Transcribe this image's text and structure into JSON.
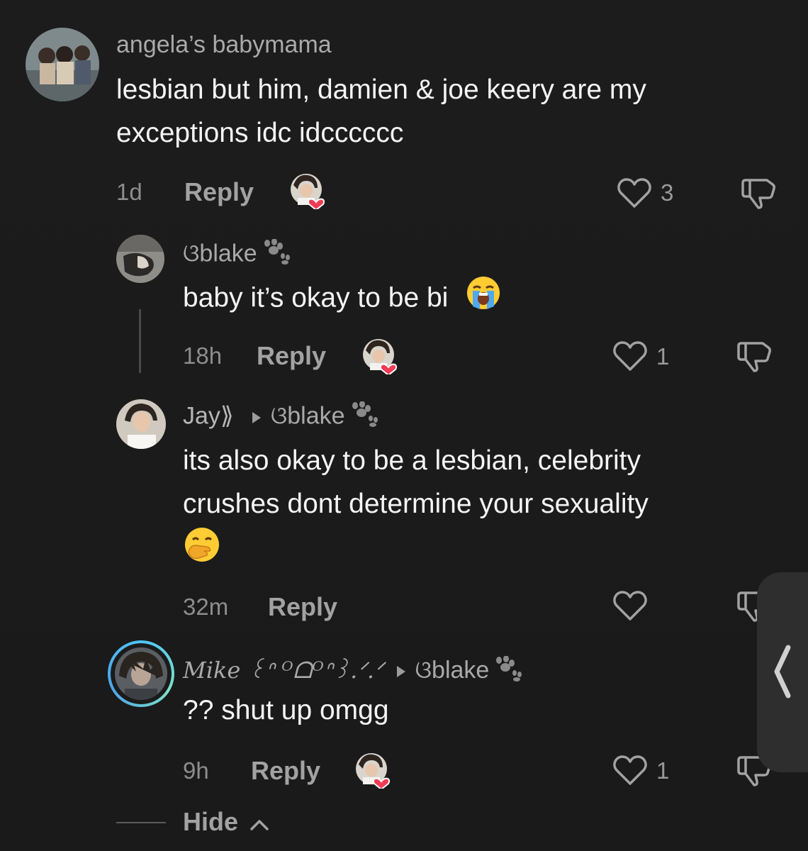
{
  "comments": [
    {
      "username": "angela’s babymama",
      "lines": [
        "lesbian but him, damien & joe keery are my",
        "exceptions idc idcccccc"
      ],
      "time": "1d",
      "reply_label": "Reply",
      "like_count": "3"
    },
    {
      "username": "ଓblake",
      "text": "baby it’s okay to be bi",
      "emoji": "loudly-crying-face",
      "time": "18h",
      "reply_label": "Reply",
      "like_count": "1"
    },
    {
      "username": "Jay⟫",
      "reply_to": "ଓblake",
      "lines": [
        "its also okay to be a lesbian, celebrity",
        "crushes dont determine your sexuality"
      ],
      "emoji": "face-with-hand-over-mouth",
      "time": "32m",
      "reply_label": "Reply",
      "like_count": ""
    },
    {
      "username": "Mike ꒰ᐢ ᴼᗝᴼᐢ꒱.ᐟ.ᐟ",
      "reply_to": "ଓblake",
      "text": "?? shut up omgg",
      "time": "9h",
      "reply_label": "Reply",
      "like_count": "1"
    }
  ],
  "hide_label": "Hide",
  "colors": {
    "background": "#1b1b1b",
    "heart_red": "#f23b54",
    "muted_text": "#a2a2a2"
  },
  "icons": [
    "heart-outline-icon",
    "dislike-icon",
    "paw-icon",
    "creator-liked-badge-icon",
    "chevron-up-icon",
    "chevron-left-icon"
  ]
}
